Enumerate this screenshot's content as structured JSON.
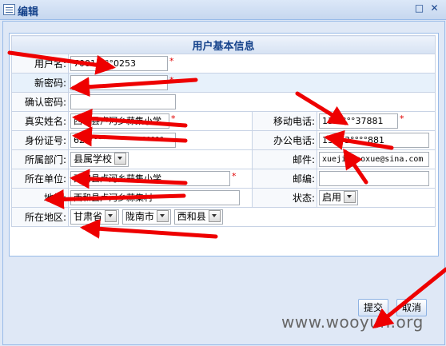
{
  "window": {
    "title": "编辑"
  },
  "form": {
    "title": "用户基本信息",
    "username": {
      "label": "用户名:",
      "value": "7001°°°°0253"
    },
    "new_password": {
      "label": "新密码:",
      "value": ""
    },
    "confirm_password": {
      "label": "确认密码:",
      "value": ""
    },
    "real_name": {
      "label": "真实姓名:",
      "value": "西和县卢河乡蒜集小学"
    },
    "mobile": {
      "label": "移动电话:",
      "value": "13°°°°°37881"
    },
    "id_number": {
      "label": "身份证号:",
      "value": "62°°°°°°°°°°°°°°°°°°"
    },
    "office_phone": {
      "label": "办公电话:",
      "value": "13993°°°°881"
    },
    "department": {
      "label": "所属部门:",
      "value": "县属学校"
    },
    "email": {
      "label": "邮件:",
      "value": "xuejixiaoxue@sina.com"
    },
    "unit": {
      "label": "所在单位:",
      "value": "西和县卢河乡蒜集小学"
    },
    "postcode": {
      "label": "邮编:",
      "value": ""
    },
    "address": {
      "label": "地址:",
      "value": "西和县卢河乡蒜集村"
    },
    "status": {
      "label": "状态:",
      "value": "启用"
    },
    "region": {
      "label": "所在地区:",
      "province": "甘肃省",
      "city": "陇南市",
      "county": "西和县"
    },
    "required_mark": "*"
  },
  "buttons": {
    "submit": "提交",
    "cancel": "取消"
  },
  "watermark": "www.wooyun.org",
  "colors": {
    "arrow": "#ee0000",
    "header_text": "#15428b",
    "panel_bg": "#dfe8f6"
  }
}
